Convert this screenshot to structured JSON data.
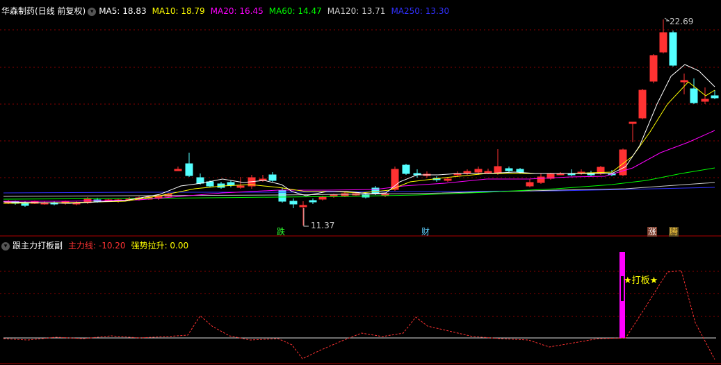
{
  "main_panel": {
    "stock_name": "华森制药",
    "period_label": "(日线 前复权)",
    "ma": [
      {
        "label": "MA5: 18.83",
        "color": "#ffffff"
      },
      {
        "label": "MA10: 18.79",
        "color": "#ffff00"
      },
      {
        "label": "MA20: 16.45",
        "color": "#ff00ff"
      },
      {
        "label": "MA60: 14.47",
        "color": "#00ff00"
      },
      {
        "label": "MA120: 13.71",
        "color": "#cccccc"
      },
      {
        "label": "MA250: 13.30",
        "color": "#3030ff"
      }
    ],
    "high_label": "22.69",
    "low_label": "11.37",
    "tags": {
      "die": "跌",
      "cai": "财",
      "zhang": "涨",
      "teng": "腾"
    }
  },
  "indicator_panel": {
    "name": "跟主力打板副",
    "line1": "主力线: -10.20",
    "line2": "强势拉升: 0.00",
    "signal_label": "★打板★"
  },
  "colors": {
    "up": "#ff3232",
    "down": "#54ffff",
    "grid": "#8b0000",
    "background": "#000000"
  }
}
